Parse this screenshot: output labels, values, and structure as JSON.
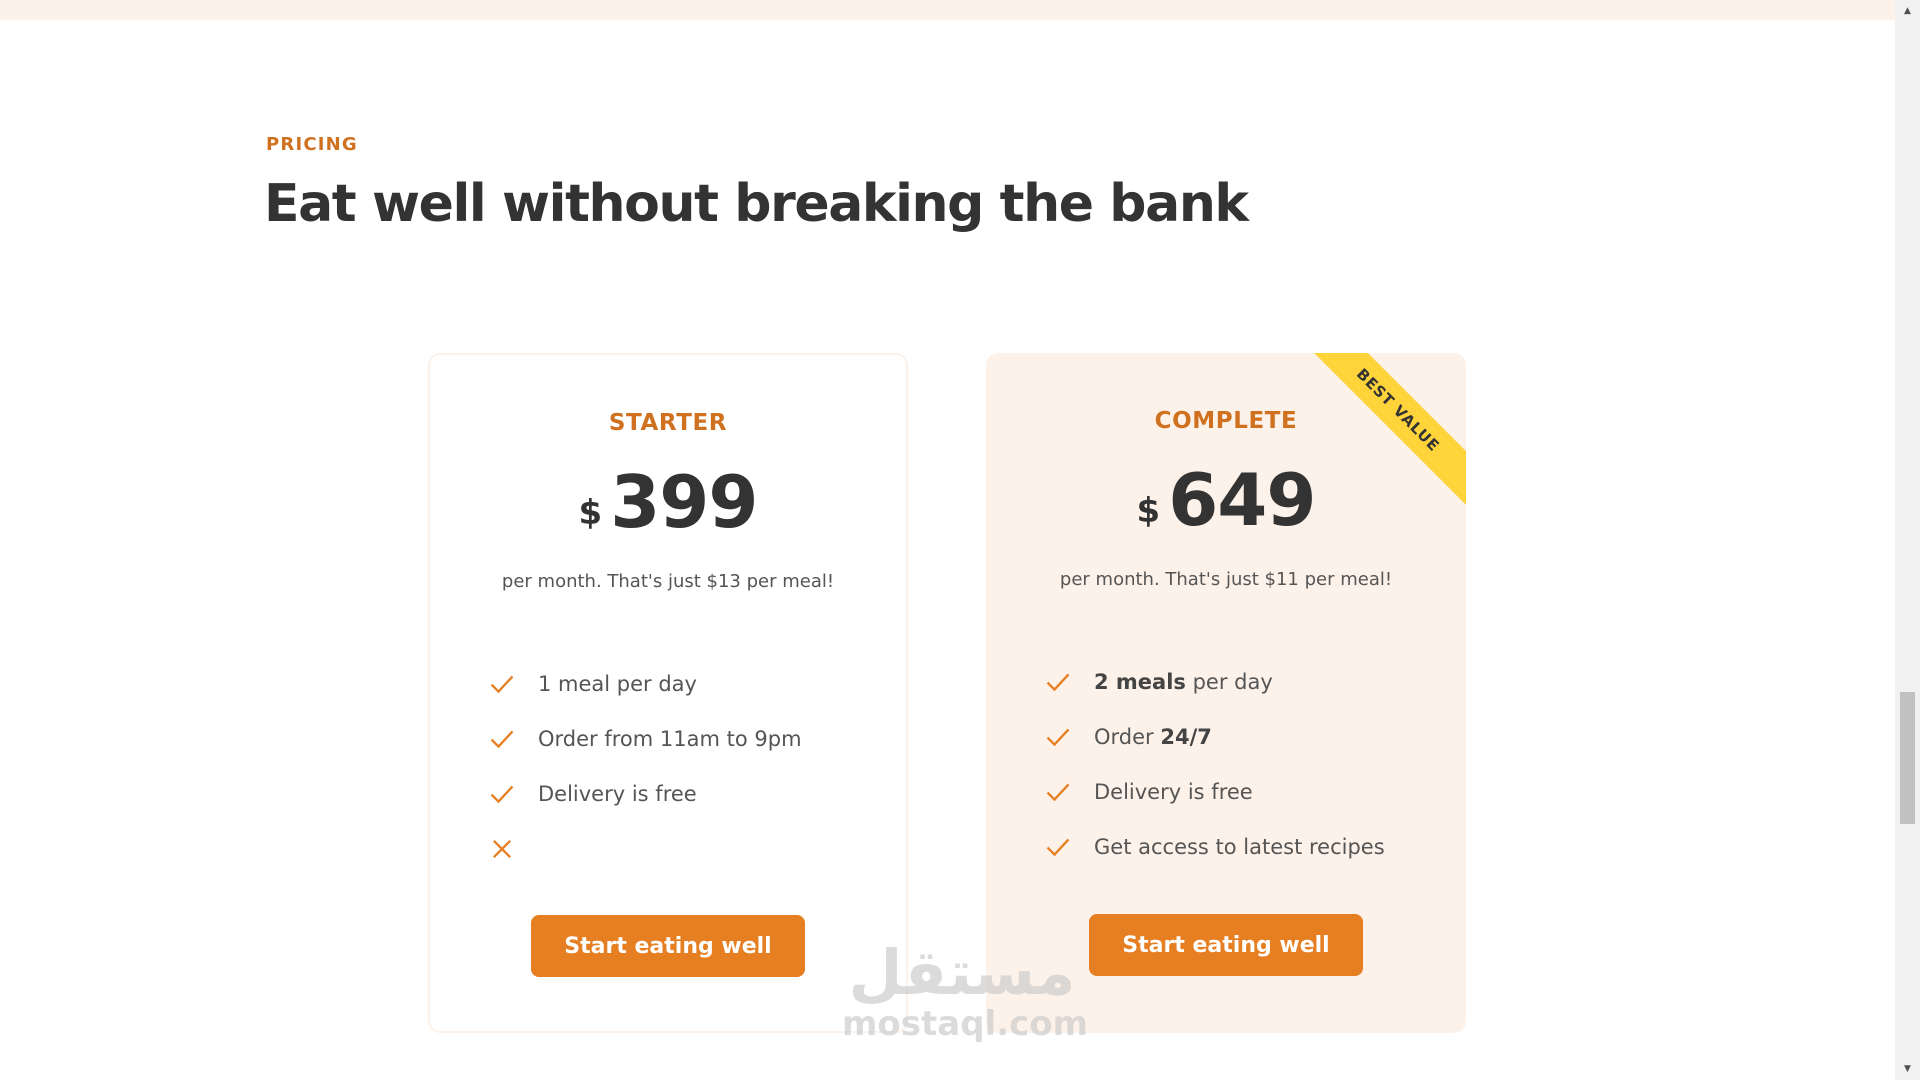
{
  "colors": {
    "accent": "#cf711f",
    "button": "#e67e22",
    "card_tint": "#fdf2e9",
    "ribbon": "#ffd43b",
    "text": "#333333"
  },
  "section": {
    "subheading": "PRICING",
    "heading": "Eat well without breaking the bank"
  },
  "plans": [
    {
      "name": "STARTER",
      "currency": "$",
      "price": "399",
      "per": "per month. That's just $13 per meal!",
      "features": [
        {
          "icon": "checkmark-icon",
          "strong": "",
          "text": "1 meal per day"
        },
        {
          "icon": "checkmark-icon",
          "strong": "",
          "text": "Order from 11am to 9pm"
        },
        {
          "icon": "checkmark-icon",
          "strong": "",
          "text": "Delivery is free"
        },
        {
          "icon": "close-icon",
          "strong": "",
          "text": ""
        }
      ],
      "button": "Start eating well"
    },
    {
      "name": "COMPLETE",
      "currency": "$",
      "price": "649",
      "per": "per month. That's just $11 per meal!",
      "ribbon": "BEST VALUE",
      "features": [
        {
          "icon": "checkmark-icon",
          "strong": "2 meals",
          "text": " per day"
        },
        {
          "icon": "checkmark-icon",
          "strong": "24/7",
          "text": "Order ",
          "strong_after": true
        },
        {
          "icon": "checkmark-icon",
          "strong": "",
          "text": "Delivery is free"
        },
        {
          "icon": "checkmark-icon",
          "strong": "",
          "text": "Get access to latest recipes"
        }
      ],
      "button": "Start eating well"
    }
  ],
  "watermark": {
    "arabic": "مستقل",
    "latin": "mostaql.com"
  }
}
